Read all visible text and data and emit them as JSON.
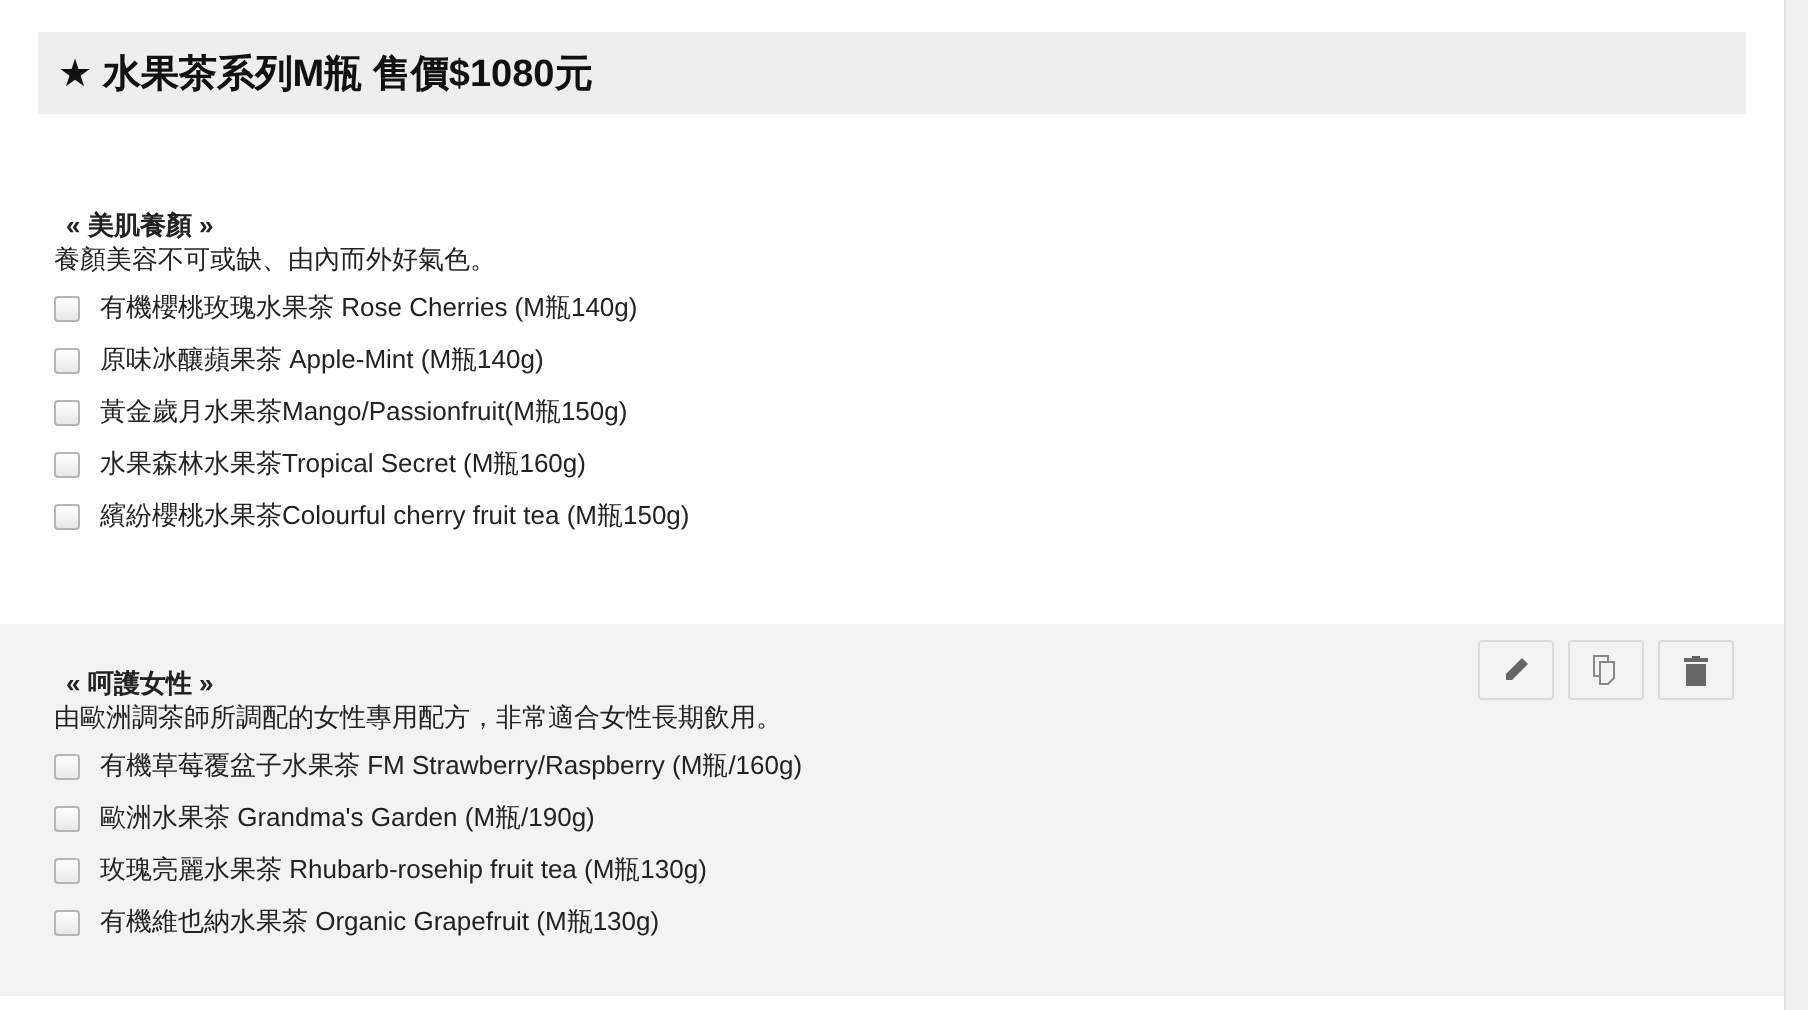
{
  "header": {
    "title": "★ 水果茶系列M瓶 售價$1080元"
  },
  "sections": [
    {
      "title": "« 美肌養顏 »",
      "description": "養顏美容不可或缺、由內而外好氣色。",
      "highlighted": false,
      "items": [
        {
          "label": "有機櫻桃玫瑰水果茶 Rose Cherries (M瓶140g)",
          "checked": false
        },
        {
          "label": "原味冰釀蘋果茶 Apple-Mint (M瓶140g)",
          "checked": false
        },
        {
          "label": "黃金歲月水果茶Mango/Passionfruit(M瓶150g)",
          "checked": false
        },
        {
          "label": "水果森林水果茶Tropical Secret (M瓶160g)",
          "checked": false
        },
        {
          "label": "繽紛櫻桃水果茶Colourful cherry fruit tea (M瓶150g)",
          "checked": false
        }
      ]
    },
    {
      "title": "« 呵護女性 »",
      "description": "由歐洲調茶師所調配的女性專用配方，非常適合女性長期飲用。",
      "highlighted": true,
      "actions": [
        {
          "kind": "edit"
        },
        {
          "kind": "copy"
        },
        {
          "kind": "delete"
        }
      ],
      "items": [
        {
          "label": "有機草莓覆盆子水果茶 FM Strawberry/Raspberry (M瓶/160g)",
          "checked": false
        },
        {
          "label": "歐洲水果茶 Grandma's Garden (M瓶/190g)",
          "checked": false
        },
        {
          "label": "玫瑰亮麗水果茶 Rhubarb-rosehip fruit tea (M瓶130g)",
          "checked": false
        },
        {
          "label": "有機維也納水果茶 Organic Grapefruit (M瓶130g)",
          "checked": false
        }
      ]
    }
  ]
}
